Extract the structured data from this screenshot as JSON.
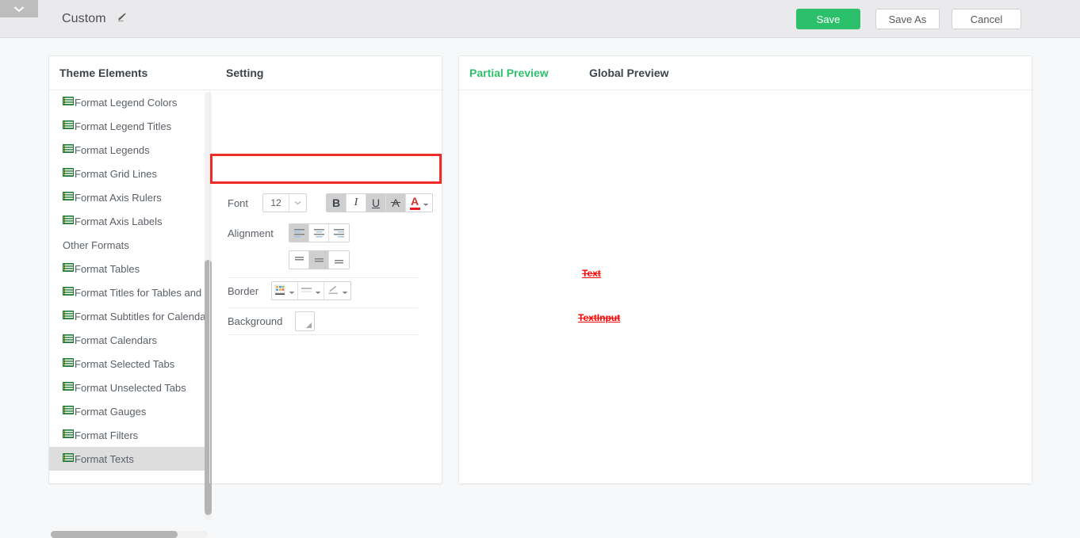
{
  "window": {
    "corner_tab_icon": "chevron-down-icon"
  },
  "header": {
    "title": "Custom",
    "edit_icon": "pencil-icon",
    "buttons": {
      "save": "Save",
      "save_as": "Save As",
      "cancel": "Cancel"
    },
    "accent_color": "#2dc06a"
  },
  "panels": {
    "elements_title": "Theme Elements",
    "setting_title": "Setting"
  },
  "theme_elements": {
    "items": [
      {
        "label": "Format Legend Colors",
        "icon": "format-list-icon",
        "type": "item",
        "selected": false
      },
      {
        "label": "Format Legend Titles",
        "icon": "format-list-icon",
        "type": "item",
        "selected": false
      },
      {
        "label": "Format Legends",
        "icon": "format-list-icon",
        "type": "item",
        "selected": false
      },
      {
        "label": "Format Grid Lines",
        "icon": "format-list-icon",
        "type": "item",
        "selected": false
      },
      {
        "label": "Format Axis Rulers",
        "icon": "format-list-icon",
        "type": "item",
        "selected": false
      },
      {
        "label": "Format Axis Labels",
        "icon": "format-list-icon",
        "type": "item",
        "selected": false
      },
      {
        "label": "Other Formats",
        "icon": "",
        "type": "group",
        "selected": false
      },
      {
        "label": "Format Tables",
        "icon": "format-list-icon",
        "type": "item",
        "selected": false
      },
      {
        "label": "Format Titles for Tables and Filt",
        "icon": "format-list-icon",
        "type": "item",
        "selected": false
      },
      {
        "label": "Format Subtitles for Calendars",
        "icon": "format-list-icon",
        "type": "item",
        "selected": false
      },
      {
        "label": "Format Calendars",
        "icon": "format-list-icon",
        "type": "item",
        "selected": false
      },
      {
        "label": "Format Selected Tabs",
        "icon": "format-list-icon",
        "type": "item",
        "selected": false
      },
      {
        "label": "Format Unselected Tabs",
        "icon": "format-list-icon",
        "type": "item",
        "selected": false
      },
      {
        "label": "Format Gauges",
        "icon": "format-list-icon",
        "type": "item",
        "selected": false
      },
      {
        "label": "Format Filters",
        "icon": "format-list-icon",
        "type": "item",
        "selected": false
      },
      {
        "label": "Format Texts",
        "icon": "format-list-icon",
        "type": "item",
        "selected": true
      }
    ]
  },
  "setting": {
    "font": {
      "label": "Font",
      "size_value": "12",
      "size_dropdown_icon": "chevron-down-icon",
      "bold": {
        "glyph": "B",
        "name": "bold-button",
        "active": true
      },
      "italic": {
        "glyph": "I",
        "name": "italic-button",
        "active": false
      },
      "underline": {
        "glyph": "U",
        "name": "underline-button",
        "active": true
      },
      "strikethrough": {
        "glyph": "A",
        "name": "strikethrough-button",
        "active": true
      },
      "font_color": {
        "glyph": "A",
        "name": "font-color-button",
        "color": "#ed1c24",
        "active": false
      },
      "highlight_box_color": "#ee2b27"
    },
    "alignment": {
      "label": "Alignment",
      "horizontal": [
        {
          "name": "align-left-button",
          "active": true
        },
        {
          "name": "align-center-button",
          "active": false
        },
        {
          "name": "align-right-button",
          "active": false
        }
      ],
      "vertical": [
        {
          "name": "align-top-button",
          "active": false
        },
        {
          "name": "align-middle-button",
          "active": true
        },
        {
          "name": "align-bottom-button",
          "active": false
        }
      ]
    },
    "border": {
      "label": "Border",
      "buttons": [
        {
          "name": "border-style-button",
          "icon": "border-grid-icon"
        },
        {
          "name": "border-line-weight-button",
          "icon": "line-weight-icon"
        },
        {
          "name": "border-color-button",
          "icon": "pencil-line-icon"
        }
      ]
    },
    "background": {
      "label": "Background",
      "swatch_name": "background-color-swatch",
      "swatch_color": "#ffffff"
    }
  },
  "preview": {
    "tabs": [
      {
        "label": "Partial Preview",
        "active": true
      },
      {
        "label": "Global Preview",
        "active": false
      }
    ],
    "samples": [
      {
        "label": "Text",
        "color": "#ff0000"
      },
      {
        "label": "TextInput",
        "color": "#ff0000"
      }
    ]
  }
}
